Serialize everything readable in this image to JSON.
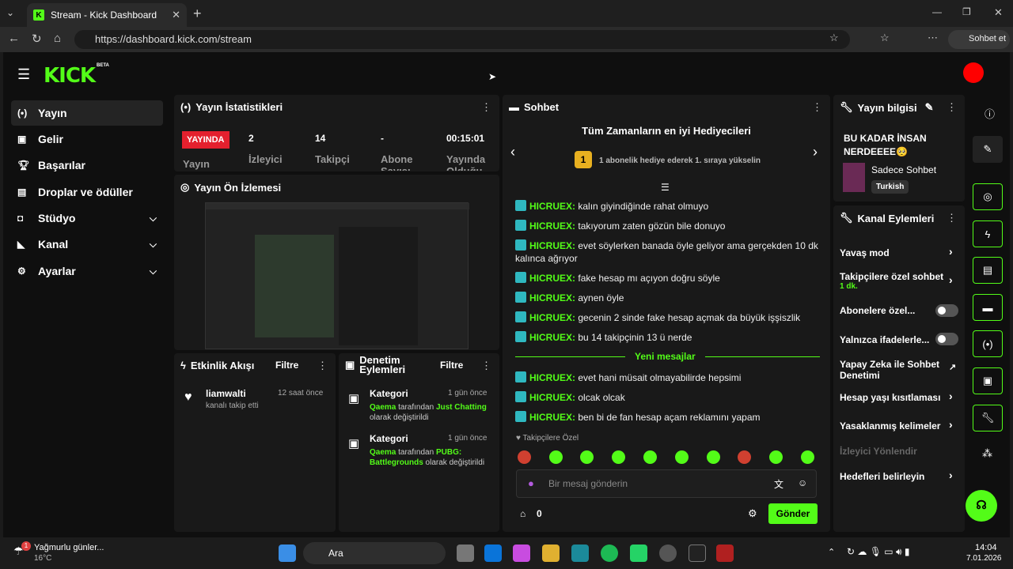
{
  "browser": {
    "tab_title": "Stream - Kick Dashboard",
    "url": "https://dashboard.kick.com/stream",
    "copilot": "Sohbet et"
  },
  "brand": {
    "logo": "KICK",
    "beta": "BETA",
    "accent": "#53fc18"
  },
  "sidebar": [
    {
      "label": "Yayın",
      "icon": "broadcast-icon"
    },
    {
      "label": "Gelir",
      "icon": "money-icon"
    },
    {
      "label": "Başarılar",
      "icon": "trophy-icon"
    },
    {
      "label": "Droplar ve ödüller",
      "icon": "gift-icon"
    },
    {
      "label": "Stüdyo",
      "icon": "studio-icon"
    },
    {
      "label": "Kanal",
      "icon": "channel-icon"
    },
    {
      "label": "Ayarlar",
      "icon": "gear-icon"
    }
  ],
  "stats": {
    "title": "Yayın İstatistikleri",
    "live": "YAYINDA",
    "items": [
      {
        "value": "2",
        "label": "İzleyici"
      },
      {
        "value": "14",
        "label": "Takipçi"
      },
      {
        "value": "-",
        "label": "Abone Sayısı"
      },
      {
        "value": "00:15:01",
        "label": "Yayında Olduğu"
      }
    ],
    "live_label": "Yayın"
  },
  "preview": {
    "title": "Yayın Ön İzlemesi"
  },
  "activity": {
    "title": "Etkinlik Akışı",
    "filter": "Filtre",
    "user": "liamwalti",
    "desc": "kanalı takip etti",
    "time": "12 saat önce"
  },
  "mod": {
    "title": "Denetim Eylemleri",
    "filter": "Filtre",
    "items": [
      {
        "title": "Kategori",
        "time": "1 gün önce",
        "who": "Qaema",
        "mid": " tarafından ",
        "cat": "Just Chatting",
        "end": " olarak değiştirildi"
      },
      {
        "title": "Kategori",
        "time": "1 gün önce",
        "who": "Qaema",
        "mid": " tarafından ",
        "cat": "PUBG: Battlegrounds",
        "end": " olarak değiştirildi"
      }
    ]
  },
  "chat": {
    "title": "Sohbet",
    "gifters_title": "Tüm Zamanların en iyi Hediyecileri",
    "gift_rank": "1",
    "gift_text": "1 abonelik hediye ederek 1. sıraya yükselin",
    "new_msgs": "Yeni mesajlar",
    "followers_only": "Takipçilere Özel",
    "placeholder": "Bir mesaj gönderin",
    "send": "Gönder",
    "count": "0",
    "messages": [
      {
        "u": "HICRUEX",
        "t": "kalın giyindiğinde rahat olmuyo"
      },
      {
        "u": "HICRUEX",
        "t": "takıyorum zaten gözün bile donuyo"
      },
      {
        "u": "HICRUEX",
        "t": "evet söylerken banada öyle geliyor ama gerçekden 10 dk kalınca ağrıyor"
      },
      {
        "u": "HICRUEX",
        "t": "fake hesap mı açıyon doğru söyle"
      },
      {
        "u": "HICRUEX",
        "t": "aynen öyle"
      },
      {
        "u": "HICRUEX",
        "t": "gecenin 2 sinde fake hesap açmak da büyük işşiszlik"
      },
      {
        "u": "HICRUEX",
        "t": "bu 14 takipçinin 13 ü nerde"
      },
      {
        "u": "HICRUEX",
        "t": "evet hani müsait olmayabilirde hepsimi"
      },
      {
        "u": "HICRUEX",
        "t": "olcak olcak"
      },
      {
        "u": "HICRUEX",
        "t": "ben bi de fan hesap açam reklamını yapam"
      }
    ]
  },
  "info": {
    "title": "Yayın bilgisi",
    "stream_title": "BU KADAR İNSAN NERDEEEE🥺",
    "category": "Sadece Sohbet",
    "lang": "Turkish"
  },
  "actions": {
    "title": "Kanal Eylemleri",
    "slow": "Yavaş mod",
    "followers": "Takipçilere özel sohbet",
    "followers_val": "1 dk.",
    "subs": "Abonelere özel...",
    "emotes": "Yalnızca ifadelerle...",
    "ai": "Yapay Zeka ile Sohbet Denetimi",
    "age": "Hesap yaşı kısıtlaması",
    "banned": "Yasaklanmış kelimeler",
    "redirect": "İzleyici Yönlendir",
    "goals": "Hedefleri belirleyin"
  },
  "taskbar": {
    "weather": "Yağmurlu günler...",
    "temp": "16°C",
    "search": "Ara",
    "time": "14:04",
    "date": "7.01.2026",
    "badge": "1"
  }
}
